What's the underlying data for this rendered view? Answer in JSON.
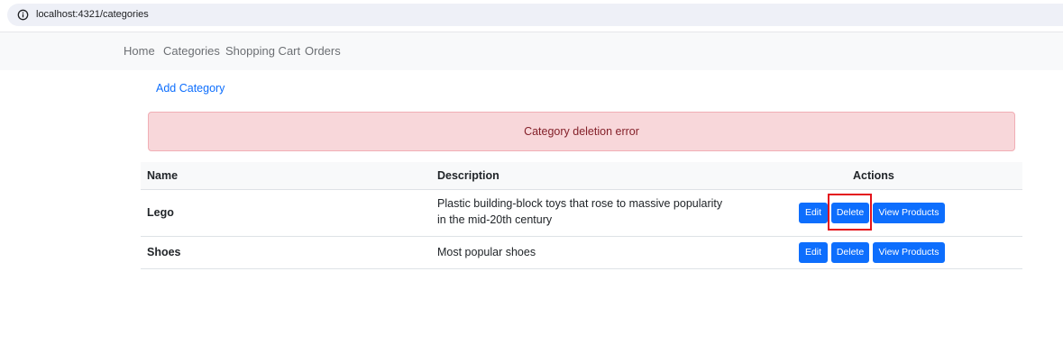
{
  "browser": {
    "url": "localhost:4321/categories",
    "info_icon": "info-circle-icon"
  },
  "nav": {
    "items": [
      {
        "label": "Home"
      },
      {
        "label": "Categories"
      },
      {
        "label": "Shopping Cart"
      },
      {
        "label": "Orders"
      }
    ]
  },
  "page": {
    "add_category": "Add Category",
    "alert": {
      "text": "Category deletion error",
      "color": "#f8d7da"
    }
  },
  "table": {
    "headers": {
      "name": "Name",
      "description": "Description",
      "actions": "Actions"
    },
    "rows": [
      {
        "name": "Lego",
        "description": "Plastic building-block toys that rose to massive popularity in the mid-20th century",
        "actions": {
          "edit": "Edit",
          "delete": "Delete",
          "view": "View Products"
        }
      },
      {
        "name": "Shoes",
        "description": "Most popular shoes",
        "actions": {
          "edit": "Edit",
          "delete": "Delete",
          "view": "View Products"
        }
      }
    ]
  },
  "colors": {
    "primary": "#0d6efd",
    "highlight": "#e4131b"
  }
}
